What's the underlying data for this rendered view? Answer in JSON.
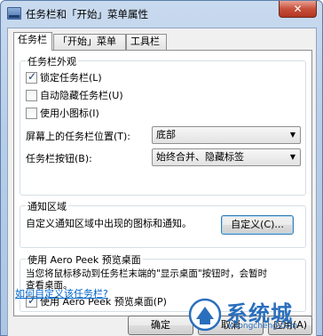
{
  "window": {
    "title": "任务栏和「开始」菜单属性",
    "close_label": "✕"
  },
  "tabs": [
    {
      "label": "任务栏",
      "active": true
    },
    {
      "label": "「开始」菜单",
      "active": false
    },
    {
      "label": "工具栏",
      "active": false
    }
  ],
  "appearance": {
    "title": "任务栏外观",
    "lock_label": "锁定任务栏(L)",
    "lock_checked": true,
    "autohide_label": "自动隐藏任务栏(U)",
    "autohide_checked": false,
    "small_icons_label": "使用小图标(I)",
    "small_icons_checked": false,
    "location_label": "屏幕上的任务栏位置(T):",
    "location_value": "底部",
    "buttons_label": "任务栏按钮(B):",
    "buttons_value": "始终合并、隐藏标签"
  },
  "notification": {
    "title": "通知区域",
    "description": "自定义通知区域中出现的图标和通知。",
    "customize_label": "自定义(C)..."
  },
  "aero_peek": {
    "title": "使用 Aero Peek 预览桌面",
    "description_line1": "当您将鼠标移动到任务栏末端的\"显示桌面\"按钮时，会暂时",
    "description_line2": "查看桌面。",
    "checkbox_label": "使用 Aero Peek 预览桌面(P)",
    "checkbox_checked": true
  },
  "help_link": "如何自定义该任务栏?",
  "buttons": {
    "ok": "确定",
    "cancel": "取消",
    "apply": "应用(A)"
  },
  "watermark": {
    "text": "系统城",
    "url": "xitongcheng.com"
  }
}
